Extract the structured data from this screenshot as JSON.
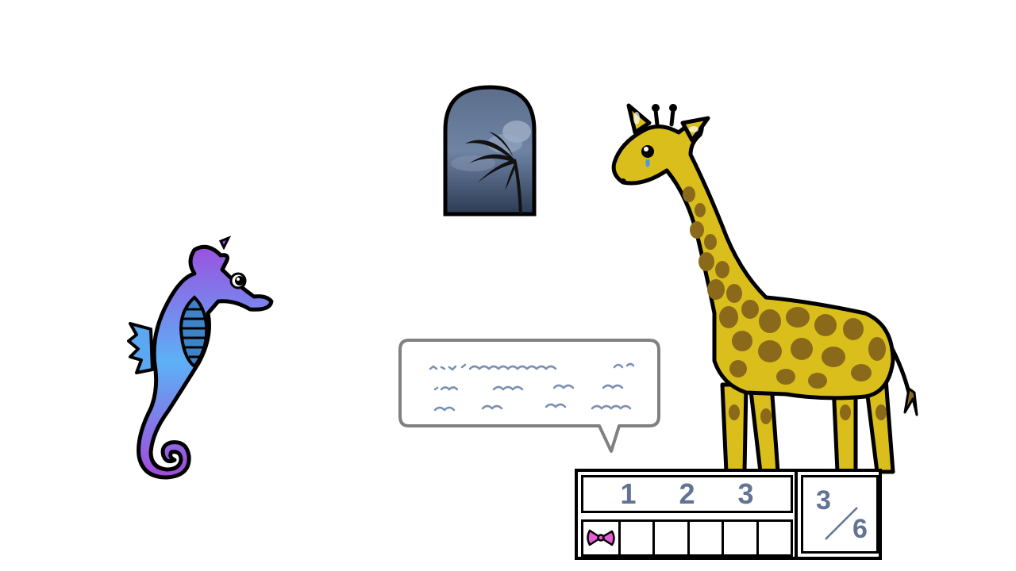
{
  "scene": {
    "window_icon": "stormy-window-icon",
    "seahorse_icon": "seahorse-icon",
    "giraffe_icon": "giraffe-icon",
    "speech_bubble_icon": "speech-bubble-icon"
  },
  "level_selector": {
    "levels": [
      "1",
      "2",
      "3"
    ]
  },
  "inventory": {
    "slot_count": 6,
    "items": [
      {
        "slot": 1,
        "icon": "pink-bow-icon"
      }
    ]
  },
  "progress": {
    "found": "3",
    "total": "6"
  },
  "colors": {
    "ui_text": "#637394",
    "seahorse_top": "#8e52e6",
    "seahorse_bottom": "#56a9f7",
    "giraffe_body": "#d9be1c",
    "giraffe_spots": "#8a6a1a",
    "bubble_border": "#808080",
    "bubble_text": "#7b8fb3"
  }
}
